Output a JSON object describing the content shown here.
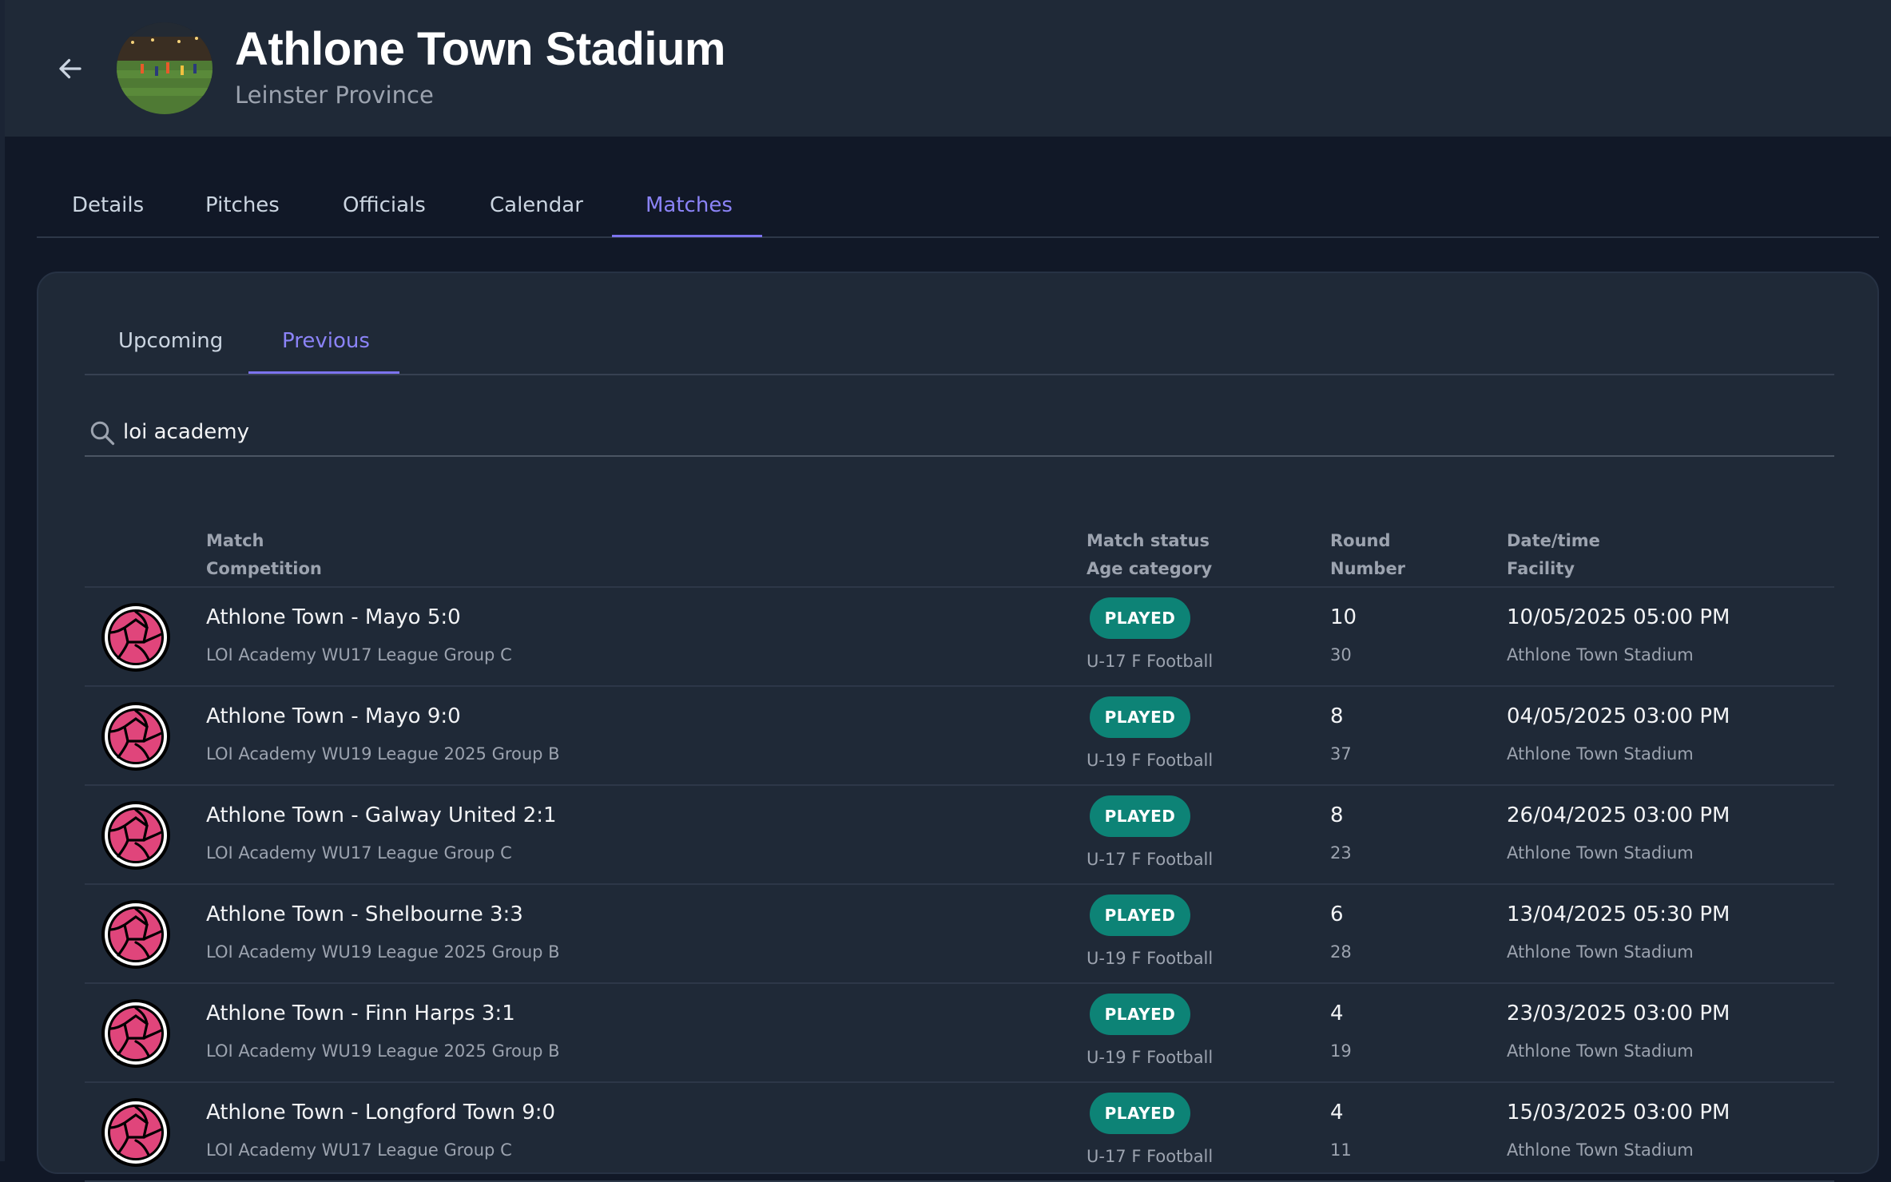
{
  "header": {
    "title": "Athlone Town Stadium",
    "subtitle": "Leinster Province",
    "back_icon": "arrow-left-icon",
    "avatar_icon": "stadium-photo"
  },
  "main_tabs": [
    {
      "label": "Details",
      "active": false
    },
    {
      "label": "Pitches",
      "active": false
    },
    {
      "label": "Officials",
      "active": false
    },
    {
      "label": "Calendar",
      "active": false
    },
    {
      "label": "Matches",
      "active": true
    }
  ],
  "sub_tabs": [
    {
      "label": "Upcoming",
      "active": false
    },
    {
      "label": "Previous",
      "active": true
    }
  ],
  "search": {
    "value": "loi academy",
    "icon": "search-icon"
  },
  "table": {
    "headers": {
      "match": "Match",
      "competition": "Competition",
      "status": "Match status",
      "age_category": "Age category",
      "round": "Round",
      "number": "Number",
      "datetime": "Date/time",
      "facility": "Facility"
    },
    "rows": [
      {
        "match": "Athlone Town - Mayo 5:0",
        "competition": "LOI Academy WU17 League Group C",
        "status": "PLAYED",
        "age": "U-17 F Football",
        "round": "10",
        "number": "30",
        "datetime": "10/05/2025 05:00 PM",
        "facility": "Athlone Town Stadium"
      },
      {
        "match": "Athlone Town - Mayo 9:0",
        "competition": "LOI Academy WU19 League 2025 Group B",
        "status": "PLAYED",
        "age": "U-19 F Football",
        "round": "8",
        "number": "37",
        "datetime": "04/05/2025 03:00 PM",
        "facility": "Athlone Town Stadium"
      },
      {
        "match": "Athlone Town - Galway United 2:1",
        "competition": "LOI Academy WU17 League Group C",
        "status": "PLAYED",
        "age": "U-17 F Football",
        "round": "8",
        "number": "23",
        "datetime": "26/04/2025 03:00 PM",
        "facility": "Athlone Town Stadium"
      },
      {
        "match": "Athlone Town - Shelbourne 3:3",
        "competition": "LOI Academy WU19 League 2025 Group B",
        "status": "PLAYED",
        "age": "U-19 F Football",
        "round": "6",
        "number": "28",
        "datetime": "13/04/2025 05:30 PM",
        "facility": "Athlone Town Stadium"
      },
      {
        "match": "Athlone Town - Finn Harps 3:1",
        "competition": "LOI Academy WU19 League 2025 Group B",
        "status": "PLAYED",
        "age": "U-19 F Football",
        "round": "4",
        "number": "19",
        "datetime": "23/03/2025 03:00 PM",
        "facility": "Athlone Town Stadium"
      },
      {
        "match": "Athlone Town - Longford Town 9:0",
        "competition": "LOI Academy WU17 League Group C",
        "status": "PLAYED",
        "age": "U-17 F Football",
        "round": "4",
        "number": "11",
        "datetime": "15/03/2025 03:00 PM",
        "facility": "Athlone Town Stadium"
      }
    ]
  },
  "colors": {
    "accent": "#7c73ee",
    "badge": "#0d8376",
    "logo": "#e0457b"
  }
}
